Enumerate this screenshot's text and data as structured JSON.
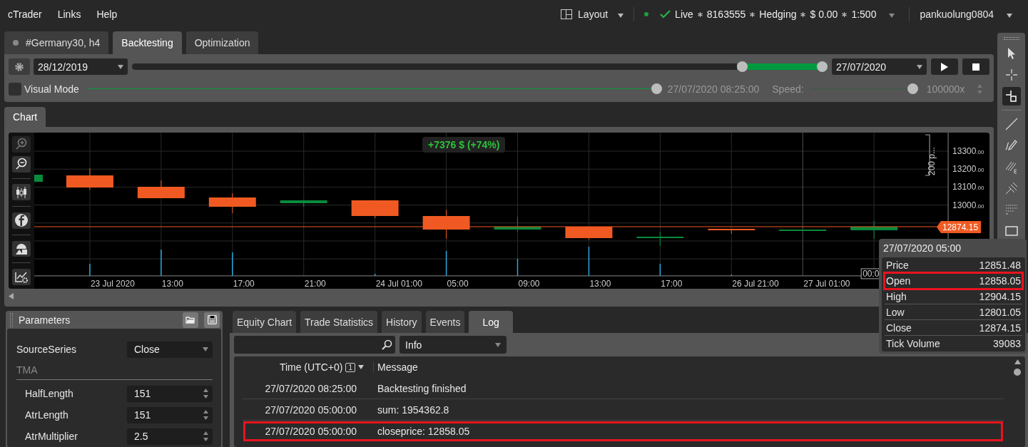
{
  "menu": [
    {
      "label": "cTrader"
    },
    {
      "label": "Links"
    },
    {
      "label": "Help"
    }
  ],
  "layout_button": {
    "label": "Layout"
  },
  "account": {
    "connected": true,
    "parts": [
      "Live",
      "8163555",
      "Hedging",
      "$ 0.00",
      "1:500"
    ]
  },
  "user": {
    "label": "pankuolung0804"
  },
  "tabs": [
    {
      "label": "#Germany30, h4",
      "kind": "symbol",
      "selected": false
    },
    {
      "label": "Backtesting",
      "kind": "plain",
      "selected": true
    },
    {
      "label": "Optimization",
      "kind": "plain",
      "selected": false
    }
  ],
  "backtest": {
    "start_date": "28/12/2019",
    "end_date": "27/07/2020",
    "period_handles": [
      {
        "level": 0.883
      },
      {
        "level": 1
      }
    ],
    "visual_mode": {
      "label": "Visual Mode",
      "checked": false
    },
    "progress": {
      "level": 1
    },
    "current_time": "27/07/2020 08:25:00",
    "speed_label": "Speed:",
    "speed": {
      "level": 1
    },
    "speed_value": "100000x"
  },
  "chart_tabs": [
    {
      "label": "Chart",
      "selected": true
    }
  ],
  "chart": {
    "profit_badge": "+7376 $ (+74%)",
    "ruler_label": "200 p...",
    "price_ticks": [
      {
        "main": "13300",
        "decimals": ".00"
      },
      {
        "main": "13200",
        "decimals": ".00"
      },
      {
        "main": "13100",
        "decimals": ".00"
      },
      {
        "main": "13000",
        "decimals": ".00"
      }
    ],
    "current_price": "12874.15",
    "time_labels": [
      "23 Jul 2020",
      "13:00",
      "17:00",
      "21:00",
      "24 Jul 01:00",
      "05:00",
      "09:00",
      "13:00",
      "17:00",
      "26 Jul 21:00",
      "27 Jul 01:00"
    ],
    "cursor_time": "00:0"
  },
  "tooltip": {
    "title": "27/07/2020 05:00",
    "rows": [
      {
        "label": "Price",
        "value": "12851.48",
        "highlighted": false
      },
      {
        "label": "Open",
        "value": "12858.05",
        "highlighted": true
      },
      {
        "label": "High",
        "value": "12904.15",
        "highlighted": false
      },
      {
        "label": "Low",
        "value": "12801.05",
        "highlighted": false
      },
      {
        "label": "Close",
        "value": "12874.15",
        "highlighted": false
      },
      {
        "label": "Tick Volume",
        "value": "39083",
        "highlighted": false
      }
    ]
  },
  "tools": [
    {
      "kind": "pointer",
      "selected": false
    },
    {
      "kind": "crosshair",
      "selected": false
    },
    {
      "kind": "snap",
      "selected": true
    },
    {
      "kind": "line",
      "selected": false
    },
    {
      "kind": "pen",
      "selected": false
    },
    {
      "kind": "fibonacci",
      "selected": false
    },
    {
      "kind": "pitchfork",
      "selected": false
    },
    {
      "kind": "grid",
      "selected": false
    },
    {
      "kind": "rectangle",
      "selected": false
    }
  ],
  "parameters": {
    "title": "Parameters",
    "items": [
      {
        "kind": "select",
        "label": "SourceSeries",
        "value": "Close"
      },
      {
        "kind": "section",
        "label": "TMA"
      },
      {
        "kind": "number",
        "label": "HalfLength",
        "value": "151"
      },
      {
        "kind": "number",
        "label": "AtrLength",
        "value": "151"
      },
      {
        "kind": "number",
        "label": "AtrMultiplier",
        "value": "2.5"
      }
    ]
  },
  "log": {
    "tabs": [
      {
        "label": "Equity Chart",
        "selected": false
      },
      {
        "label": "Trade Statistics",
        "selected": false
      },
      {
        "label": "History",
        "selected": false
      },
      {
        "label": "Events",
        "selected": false
      },
      {
        "label": "Log",
        "selected": true
      }
    ],
    "level_filter": "Info",
    "columns": [
      {
        "label": "Time (UTC+0)",
        "sort_badge": "1"
      },
      {
        "label": "Message"
      }
    ],
    "rows": [
      {
        "time": "27/07/2020 08:25:00",
        "message": "Backtesting finished",
        "highlighted": false
      },
      {
        "time": "27/07/2020 05:00:00",
        "message": "sum: 1954362.8",
        "highlighted": false
      },
      {
        "time": "27/07/2020 05:00:00",
        "message": "closeprice: 12858.05",
        "highlighted": true
      }
    ]
  }
}
